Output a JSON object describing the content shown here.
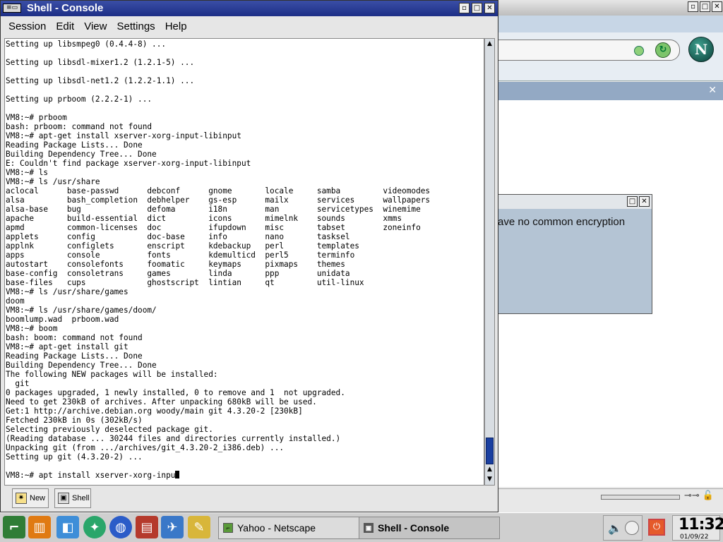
{
  "console": {
    "title": "Shell - Console",
    "sys_icon": "≡▭",
    "menu": [
      "Session",
      "Edit",
      "View",
      "Settings",
      "Help"
    ],
    "lines": [
      "Setting up libsmpeg0 (0.4.4-8) ...",
      "",
      "Setting up libsdl-mixer1.2 (1.2.1-5) ...",
      "",
      "Setting up libsdl-net1.2 (1.2.2-1.1) ...",
      "",
      "Setting up prboom (2.2.2-1) ...",
      "",
      "VM8:~# prboom",
      "bash: prboom: command not found",
      "VM8:~# apt-get install xserver-xorg-input-libinput",
      "Reading Package Lists... Done",
      "Building Dependency Tree... Done",
      "E: Couldn't find package xserver-xorg-input-libinput",
      "VM8:~# ls",
      "VM8:~# ls /usr/share",
      "aclocal      base-passwd      debconf      gnome       locale     samba         videomodes",
      "alsa         bash_completion  debhelper    gs-esp      mailx      services      wallpapers",
      "alsa-base    bug              defoma       i18n        man        servicetypes  winemime",
      "apache       build-essential  dict         icons       mimelnk    sounds        xmms",
      "apmd         common-licenses  doc          ifupdown    misc       tabset        zoneinfo",
      "applets      config           doc-base     info        nano       tasksel",
      "applnk       configlets       enscript     kdebackup   perl       templates",
      "apps         console          fonts        kdemulticd  perl5      terminfo",
      "autostart    consolefonts     foomatic     keymaps     pixmaps    themes",
      "base-config  consoletrans     games        linda       ppp        unidata",
      "base-files   cups             ghostscript  lintian     qt         util-linux",
      "VM8:~# ls /usr/share/games",
      "doom",
      "VM8:~# ls /usr/share/games/doom/",
      "boomlump.wad  prboom.wad",
      "VM8:~# boom",
      "bash: boom: command not found",
      "VM8:~# apt-get install git",
      "Reading Package Lists... Done",
      "Building Dependency Tree... Done",
      "The following NEW packages will be installed:",
      "  git",
      "0 packages upgraded, 1 newly installed, 0 to remove and 1  not upgraded.",
      "Need to get 230kB of archives. After unpacking 680kB will be used.",
      "Get:1 http://archive.debian.org woody/main git 4.3.20-2 [230kB]",
      "Fetched 230kB in 0s (302kB/s)",
      "Selecting previously deselected package git.",
      "(Reading database ... 30244 files and directories currently installed.)",
      "Unpacking git (from .../archives/git_4.3.20-2_i386.deb) ...",
      "Setting up git (4.3.20-2) ...",
      ""
    ],
    "prompt": "VM8:~# apt install xserver-xorg-inpu",
    "tabs": [
      "New",
      "Shell"
    ]
  },
  "dialog": {
    "text": "ave no common encryption"
  },
  "netscape": {
    "logo": "N"
  },
  "taskbar": {
    "tasks": [
      "Yahoo - Netscape",
      "Shell - Console"
    ],
    "clock_time": "11:32",
    "clock_date": "01/09/22"
  },
  "colors": {
    "titlebar": "#1d2f86",
    "scroll_thumb": "#1a3fa0",
    "desktop": "#6e7f9a"
  }
}
